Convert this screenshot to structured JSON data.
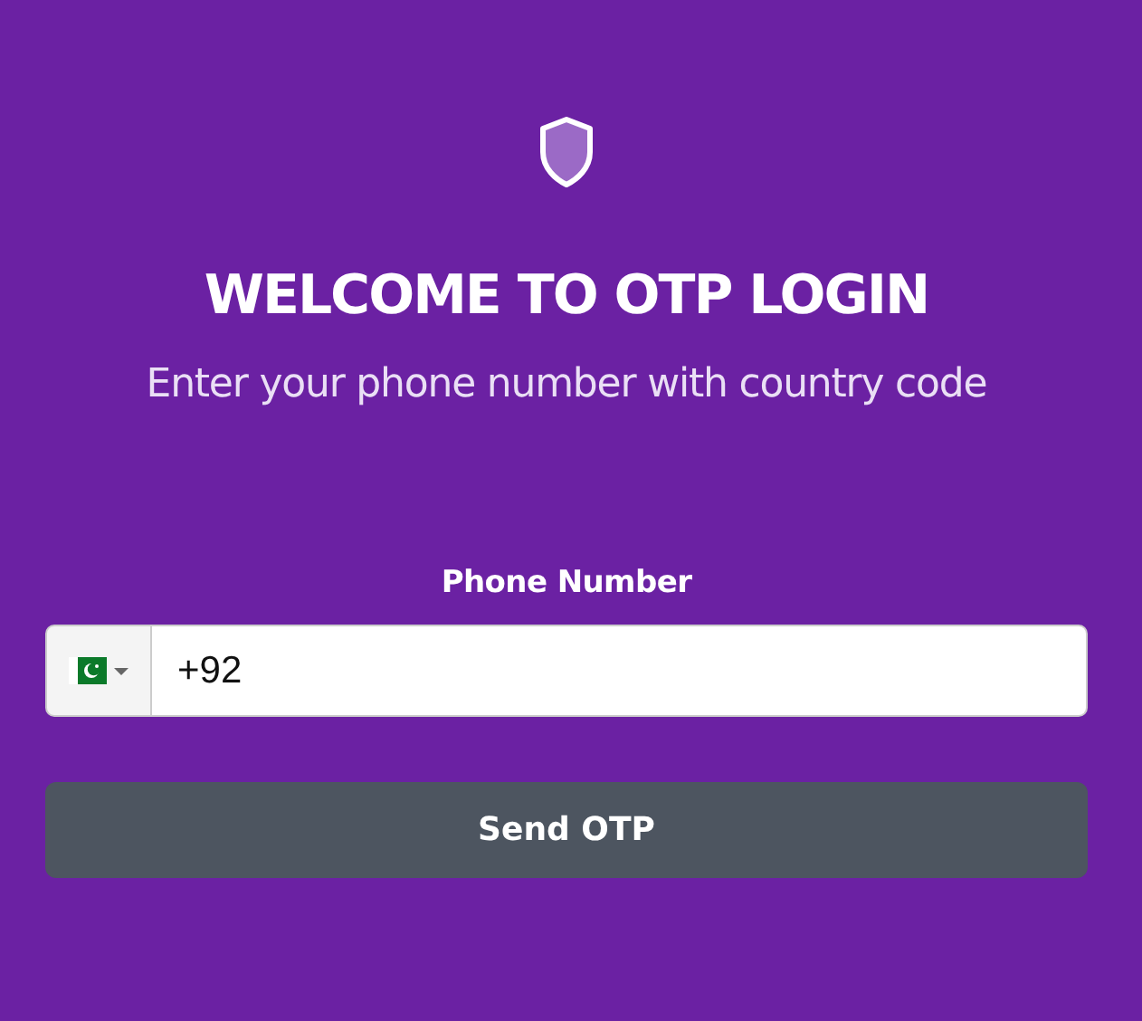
{
  "title": "WELCOME TO OTP LOGIN",
  "subtitle": "Enter your phone number with country code",
  "phone": {
    "label": "Phone Number",
    "value": "+92"
  },
  "button": "Send OTP"
}
